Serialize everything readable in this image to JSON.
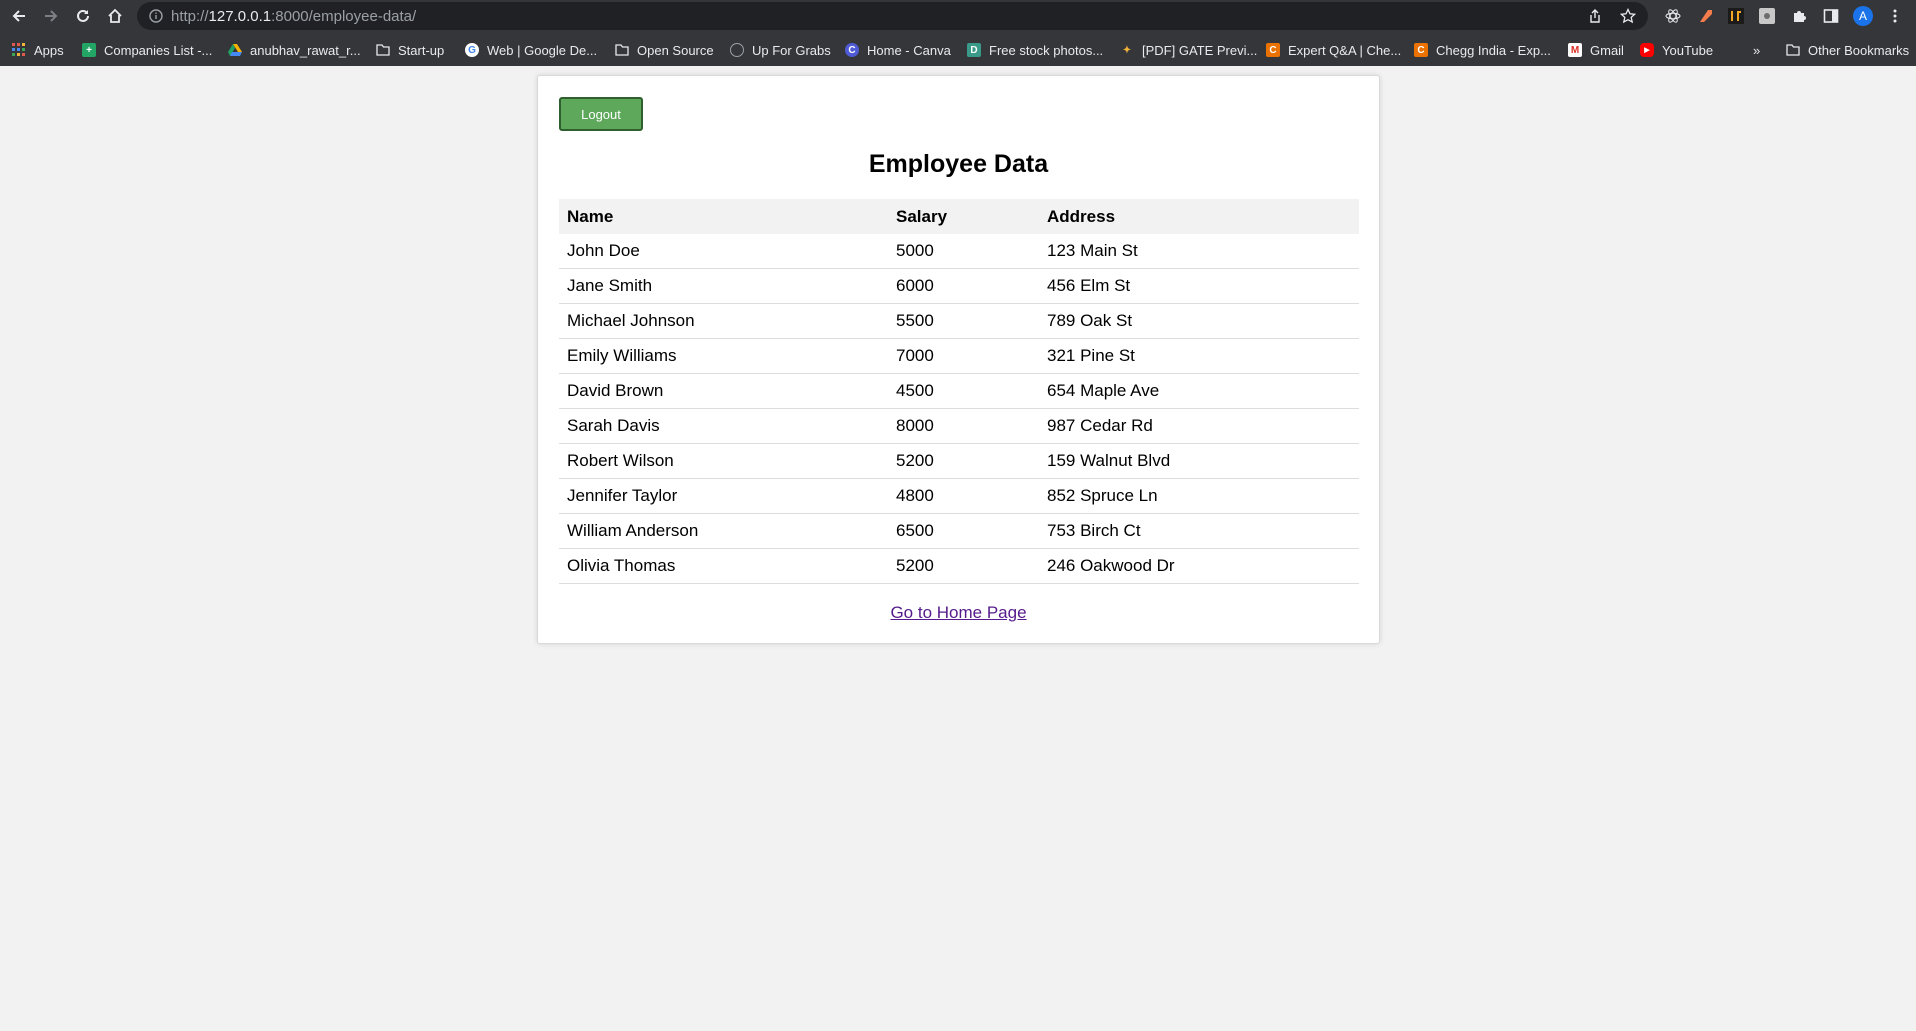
{
  "browser": {
    "url_scheme": "http://",
    "url_host": "127.0.0.1",
    "url_path": ":8000/employee-data/",
    "profile_initial": "A",
    "bookmarks": [
      {
        "label": "Apps",
        "icon": "apps-grid-icon"
      },
      {
        "label": "Companies List -...",
        "icon": "sheets-icon"
      },
      {
        "label": "anubhav_rawat_r...",
        "icon": "drive-icon"
      },
      {
        "label": "Start-up",
        "icon": "folder-icon"
      },
      {
        "label": "Web | Google De...",
        "icon": "google-icon"
      },
      {
        "label": "Open Source",
        "icon": "folder-icon"
      },
      {
        "label": "Up For Grabs",
        "icon": "globe-icon"
      },
      {
        "label": "Home - Canva",
        "icon": "canva-icon"
      },
      {
        "label": "Free stock photos...",
        "icon": "photos-icon"
      },
      {
        "label": "[PDF] GATE Previ...",
        "icon": "pdf-icon"
      },
      {
        "label": "Expert Q&A | Che...",
        "icon": "chegg-icon"
      },
      {
        "label": "Chegg India - Exp...",
        "icon": "chegg-icon"
      },
      {
        "label": "Gmail",
        "icon": "gmail-icon"
      },
      {
        "label": "YouTube",
        "icon": "youtube-icon"
      }
    ],
    "overflow_label": "»",
    "other_bookmarks": "Other Bookmarks"
  },
  "page": {
    "logout_label": "Logout",
    "title": "Employee Data",
    "columns": [
      "Name",
      "Salary",
      "Address"
    ],
    "rows": [
      [
        "John Doe",
        "5000",
        "123 Main St"
      ],
      [
        "Jane Smith",
        "6000",
        "456 Elm St"
      ],
      [
        "Michael Johnson",
        "5500",
        "789 Oak St"
      ],
      [
        "Emily Williams",
        "7000",
        "321 Pine St"
      ],
      [
        "David Brown",
        "4500",
        "654 Maple Ave"
      ],
      [
        "Sarah Davis",
        "8000",
        "987 Cedar Rd"
      ],
      [
        "Robert Wilson",
        "5200",
        "159 Walnut Blvd"
      ],
      [
        "Jennifer Taylor",
        "4800",
        "852 Spruce Ln"
      ],
      [
        "William Anderson",
        "6500",
        "753 Birch Ct"
      ],
      [
        "Olivia Thomas",
        "5200",
        "246 Oakwood Dr"
      ]
    ],
    "home_link": "Go to Home Page"
  },
  "colors": {
    "logout_bg": "#5da85a",
    "link": "#551a8b",
    "header_bg": "#f2f2f2"
  }
}
